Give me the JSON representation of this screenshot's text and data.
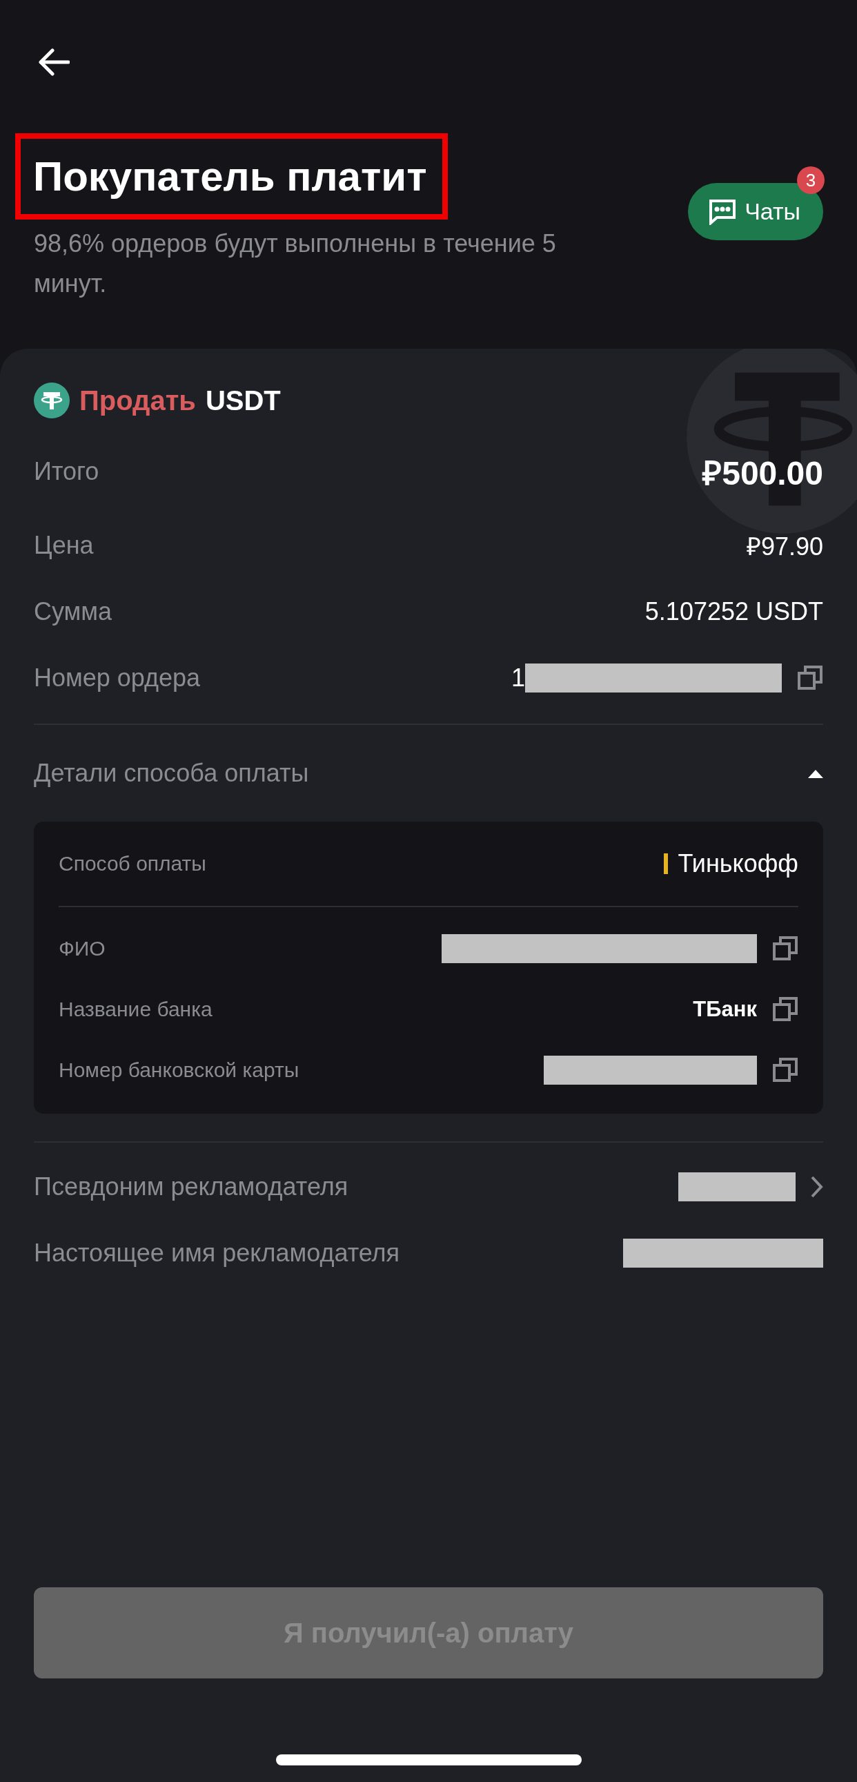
{
  "header": {
    "title": "Покупатель платит",
    "title_highlighted": true,
    "subtitle": "98,6% ордеров будут выполнены в течение 5 минут.",
    "chat_button": {
      "label": "Чаты",
      "badge": "3"
    }
  },
  "order": {
    "side": "Продать",
    "asset": "USDT",
    "rows": [
      {
        "label": "Итого",
        "value": "₽500.00",
        "kind": "total",
        "copyable": false
      },
      {
        "label": "Цена",
        "value": "₽97.90",
        "kind": "plain",
        "copyable": false
      },
      {
        "label": "Сумма",
        "value": "5.107252 USDT",
        "kind": "plain",
        "copyable": false
      },
      {
        "label": "Номер ордера",
        "value": "1",
        "kind": "redacted",
        "copyable": true
      }
    ]
  },
  "payment_details": {
    "title": "Детали способа оплаты",
    "expanded": true,
    "method": {
      "label": "Способ оплаты",
      "value": "Тинькофф"
    },
    "fields": [
      {
        "label": "ФИО",
        "kind": "redacted",
        "copyable": true
      },
      {
        "label": "Название банка",
        "value": "ТБанк",
        "kind": "text",
        "copyable": true
      },
      {
        "label": "Номер банковской карты",
        "kind": "redacted",
        "copyable": true
      }
    ]
  },
  "advertiser": [
    {
      "label": "Псевдоним рекламодателя",
      "kind": "link"
    },
    {
      "label": "Настоящее имя рекламодателя",
      "kind": "redacted"
    }
  ],
  "confirm_button": {
    "label": "Я получил(-а) оплату",
    "disabled": true
  }
}
